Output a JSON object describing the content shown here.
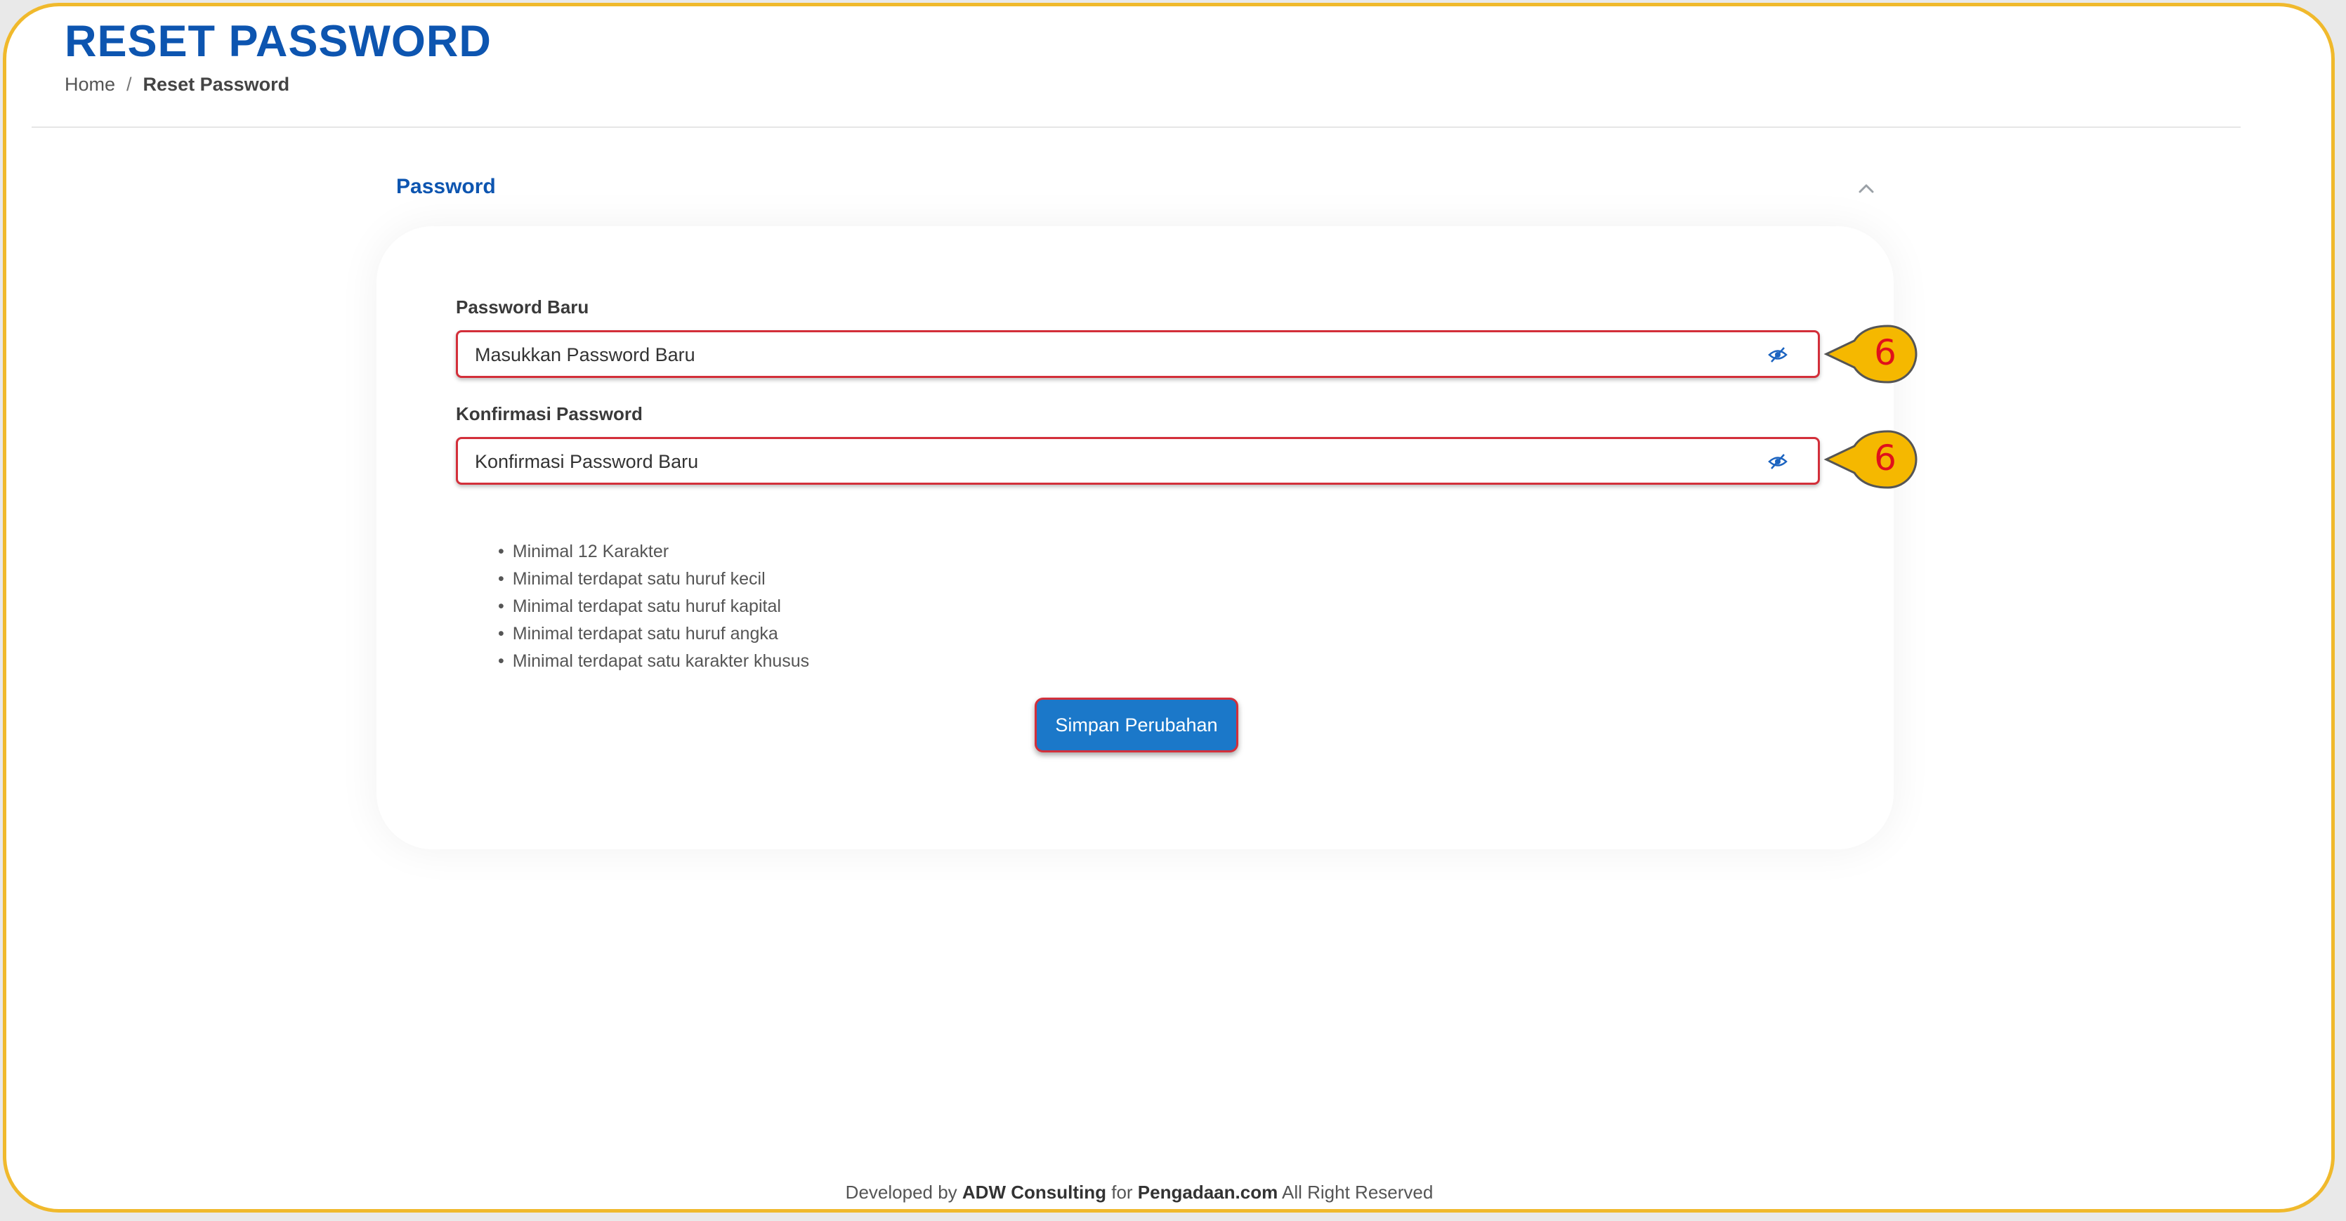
{
  "header": {
    "title": "RESET PASSWORD",
    "breadcrumb": {
      "home": "Home",
      "separator": "/",
      "current": "Reset Password"
    }
  },
  "section": {
    "title": "Password",
    "collapse_icon": "chevron-up-icon"
  },
  "form": {
    "new_password": {
      "label": "Password Baru",
      "placeholder": "Masukkan Password Baru",
      "icon": "eye-slash-icon"
    },
    "confirm_password": {
      "label": "Konfirmasi Password",
      "placeholder": "Konfirmasi Password Baru",
      "icon": "eye-slash-icon"
    },
    "requirements": [
      "Minimal 12 Karakter",
      "Minimal terdapat satu huruf kecil",
      "Minimal terdapat satu huruf kapital",
      "Minimal terdapat satu huruf angka",
      "Minimal terdapat satu karakter khusus"
    ],
    "save_label": "Simpan Perubahan"
  },
  "annotations": [
    {
      "number": "6"
    },
    {
      "number": "6"
    }
  ],
  "footer": {
    "prefix": "Developed by",
    "company": "ADW Consulting",
    "middle": "for",
    "site": "Pengadaan.com",
    "suffix": "All Right Reserved"
  },
  "colors": {
    "primary": "#0d55b0",
    "button": "#1b78c9",
    "highlight_border": "#d32f3a",
    "callout": "#f5b800",
    "frame": "#f0b92c"
  }
}
